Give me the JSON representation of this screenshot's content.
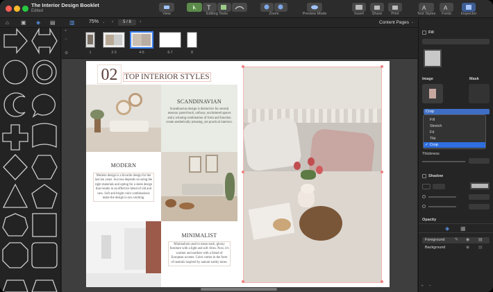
{
  "window": {
    "title": "The Interior Design Booklet",
    "subtitle": "Edited"
  },
  "toolbar": {
    "view": "View",
    "editing_tools": "Editing Tools",
    "zoom": "Zoom",
    "preview_mode": "Preview Mode",
    "insert": "Insert",
    "share": "Share",
    "print": "Print",
    "text_styles": "Text Styles",
    "fonts": "Fonts",
    "inspector": "Inspector"
  },
  "subbar": {
    "zoom_value": "75%",
    "page_indicator": "5 / 8",
    "content_pages": "Content Pages"
  },
  "thumbnails": {
    "labels": [
      "1",
      "2-3",
      "4-5",
      "6-7",
      "8"
    ],
    "selected": "4-5"
  },
  "page": {
    "number": "02",
    "title": "TOP INTERIOR STYLES",
    "sections": [
      {
        "heading": "SCANDINAVIAN",
        "body": "Scandinavian design is distinctive for several reasons: pared-back, unfussy, uncluttered spaces and a winning combination of form and function create aesthetically pleasing, yet practical interiors."
      },
      {
        "heading": "MODERN",
        "body": "Modern design is a favorite design for the last ten years. Success depends on using the right materials and opting for a sleek design that results in an effective blend of old and new. Soft and bright color combinations make the design is eye catching."
      },
      {
        "heading": "MINIMALIST",
        "body": "Minimalism used to mean stark, glossy furniture with a light and soft vibes. Now, it's warmer and earthier with a blend of European accents. Color comes in the form of neutrals inspired by natural earthy tones."
      }
    ]
  },
  "inspector": {
    "fill_label": "Fill",
    "image_label": "Image",
    "mask_label": "Mask",
    "crop_selected": "Crop",
    "crop_options": [
      "Fill",
      "Stretch",
      "Fit",
      "Tile",
      "Crop"
    ],
    "thickness_label": "Thickness",
    "shadow_label": "Shadow",
    "opacity_label": "Opacity",
    "layers": [
      "Foreground",
      "Background"
    ]
  },
  "colors": {
    "accent": "#2f6fe0",
    "window_bg": "#262626",
    "toolbar_button": "#484848"
  }
}
